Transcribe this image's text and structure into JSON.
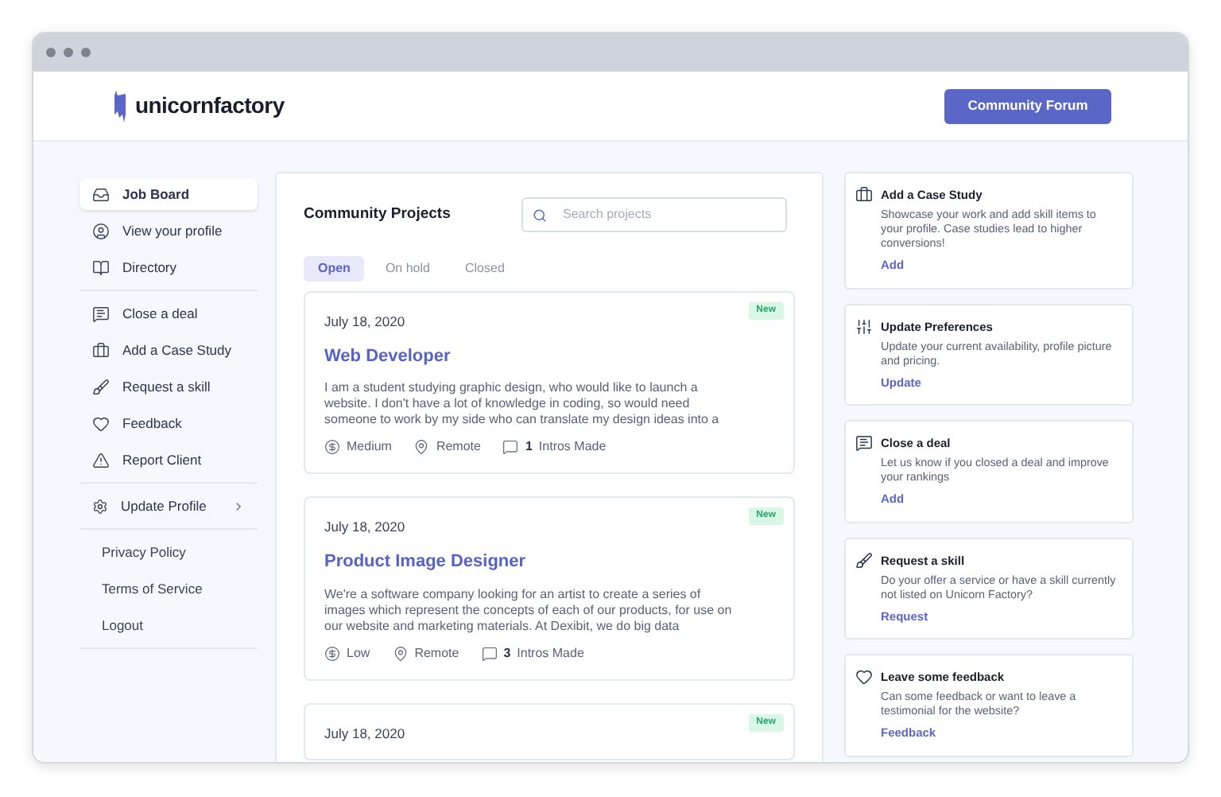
{
  "header": {
    "logo_text": "unicornfactory",
    "button": "Community Forum"
  },
  "sidebar": {
    "sections": [
      {
        "kind": "nav",
        "items": [
          {
            "label": "Job Board",
            "selected": true
          },
          {
            "label": "View your profile",
            "selected": false
          },
          {
            "label": "Directory",
            "selected": false
          }
        ]
      },
      {
        "kind": "nav",
        "items": [
          {
            "label": "Close a deal",
            "selected": false
          },
          {
            "label": "Add a Case Study",
            "selected": false
          },
          {
            "label": "Request a skill",
            "selected": false
          },
          {
            "label": "Feedback",
            "selected": false
          },
          {
            "label": "Report Client",
            "selected": false
          }
        ]
      },
      {
        "kind": "submenu",
        "items": [
          {
            "label": "Update Profile",
            "selected": false
          }
        ]
      },
      {
        "kind": "links",
        "items": [
          {
            "label": "Privacy Policy",
            "selected": false
          },
          {
            "label": "Terms of Service",
            "selected": false
          },
          {
            "label": "Logout",
            "selected": false
          }
        ]
      }
    ]
  },
  "projects": {
    "title": "Community Projects",
    "search": {
      "placeholder": "Search projects"
    },
    "tabs": [
      {
        "label": "Open",
        "selected": true
      },
      {
        "label": "On hold",
        "selected": false
      },
      {
        "label": "Closed",
        "selected": false
      }
    ],
    "cards": [
      {
        "date": "July 18, 2020",
        "badge": "New",
        "title": "Web Developer",
        "description": "I am a student studying graphic design, who would like to launch a website. I don't have a lot of knowledge in coding, so would need someone to work by my side who can translate my design ideas into a",
        "budget": "Medium",
        "location": "Remote",
        "intros_count": "1",
        "intros_label": "Intros Made"
      },
      {
        "date": "July 18, 2020",
        "badge": "New",
        "title": "Product Image Designer",
        "description": "We're a software company looking for an artist to create a series of images which represent the concepts of each of our products, for use on our website and marketing materials. At Dexibit, we do big data",
        "budget": "Low",
        "location": "Remote",
        "intros_count": "3",
        "intros_label": "Intros Made"
      },
      {
        "date": "July 18, 2020",
        "badge": "New"
      }
    ]
  },
  "actions": [
    {
      "title": "Add a Case Study",
      "text": "Showcase your work and add skill items to your profile. Case studies lead to higher conversions!",
      "link": "Add"
    },
    {
      "title": "Update Preferences",
      "text": "Update your current availability, profile picture and pricing.",
      "link": "Update"
    },
    {
      "title": "Close a deal",
      "text": "Let us know if you closed a deal and improve your rankings",
      "link": "Add"
    },
    {
      "title": "Request a skill",
      "text": "Do your offer a service or have a skill currently not listed on Unicorn Factory?",
      "link": "Request"
    },
    {
      "title": "Leave some feedback",
      "text": "Can some feedback or want to leave a testimonial for the website?",
      "link": "Feedback"
    }
  ]
}
